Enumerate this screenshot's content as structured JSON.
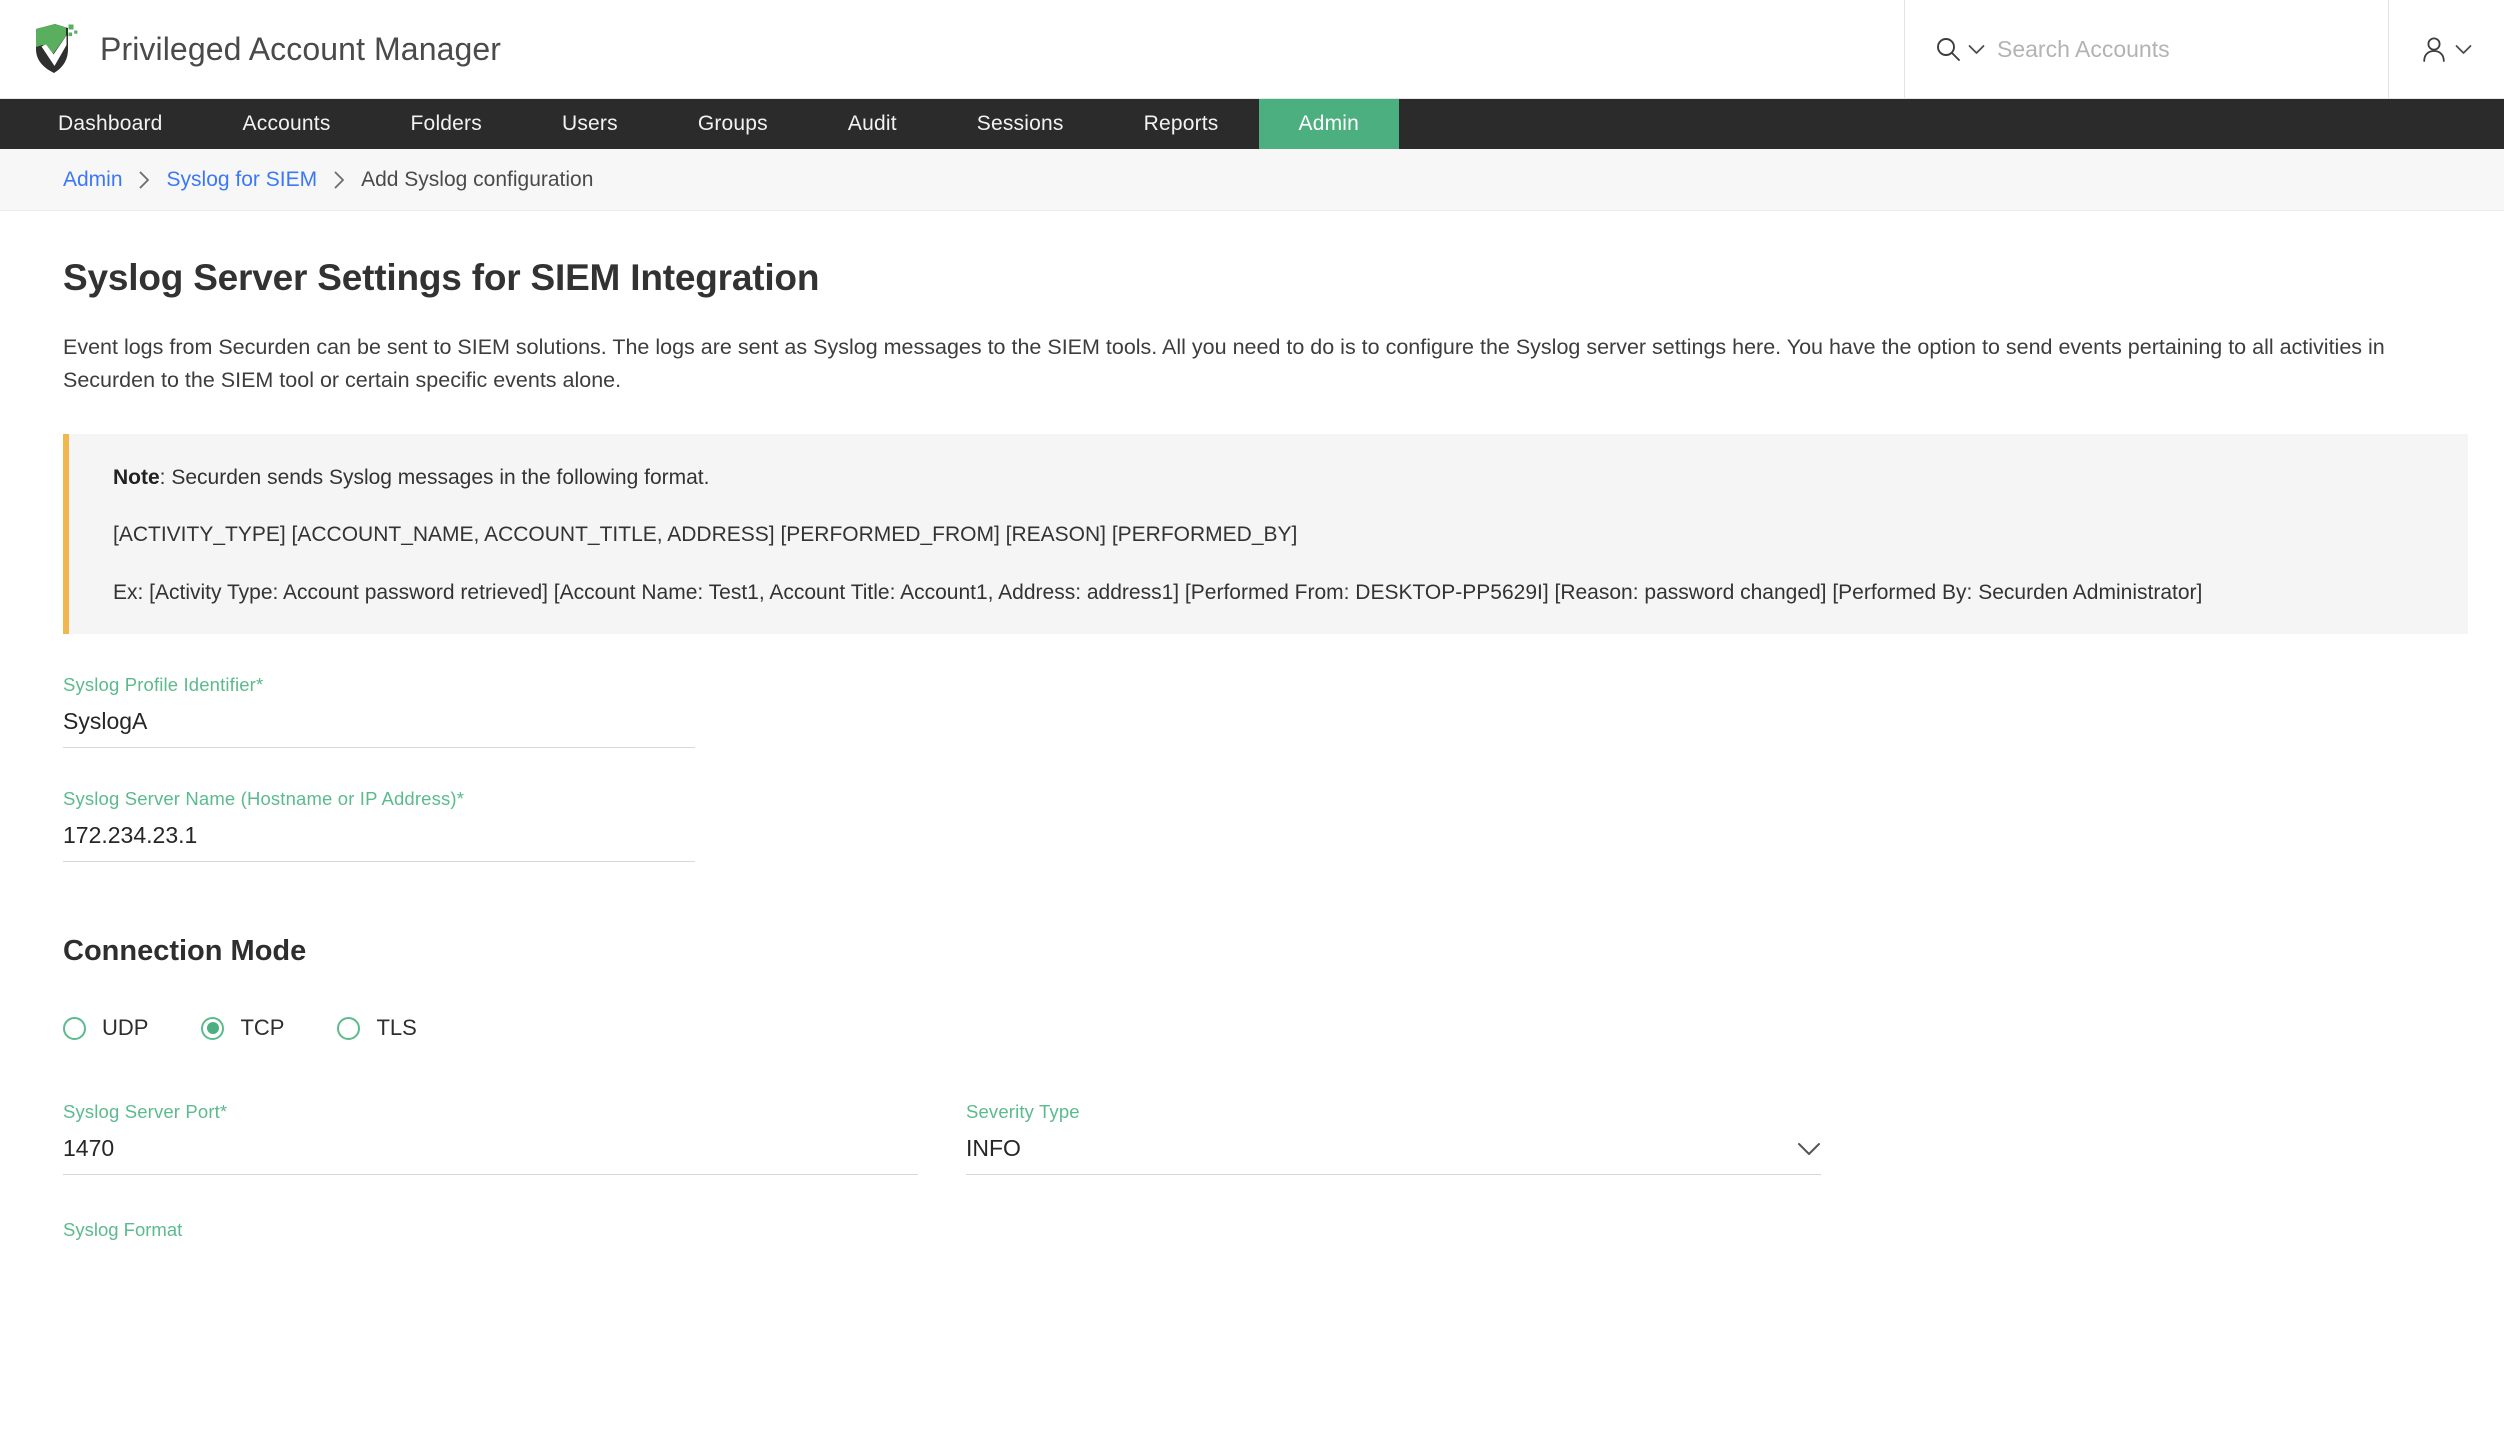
{
  "header": {
    "brand_title": "Privileged Account Manager",
    "logo_icon": "shield-logo-icon",
    "search_icon": "search-icon",
    "search_chevron_icon": "chevron-down-icon",
    "search_placeholder": "Search Accounts",
    "search_value": "",
    "user_icon": "user-icon",
    "user_chevron_icon": "chevron-down-icon"
  },
  "nav": {
    "items": [
      {
        "label": "Dashboard",
        "active": false
      },
      {
        "label": "Accounts",
        "active": false
      },
      {
        "label": "Folders",
        "active": false
      },
      {
        "label": "Users",
        "active": false
      },
      {
        "label": "Groups",
        "active": false
      },
      {
        "label": "Audit",
        "active": false
      },
      {
        "label": "Sessions",
        "active": false
      },
      {
        "label": "Reports",
        "active": false
      },
      {
        "label": "Admin",
        "active": true
      }
    ],
    "active_color": "#4caf7f",
    "bar_color": "#2b2b2b"
  },
  "breadcrumb": {
    "items": [
      {
        "label": "Admin",
        "is_link": true
      },
      {
        "label": "Syslog for SIEM",
        "is_link": true
      },
      {
        "label": "Add Syslog configuration",
        "is_link": false
      }
    ],
    "separator_icon": "chevron-right-icon",
    "link_color": "#3b78f7"
  },
  "page": {
    "title": "Syslog Server Settings for SIEM Integration",
    "description": "Event logs from Securden can be sent to SIEM solutions. The logs are sent as Syslog messages to the SIEM tools. All you need to do is to configure the Syslog server settings here. You have the option to send events pertaining to all activities in Securden to the SIEM tool or certain specific events alone."
  },
  "note": {
    "accent_color": "#f2b64e",
    "background_color": "#f5f5f5",
    "label": "Note",
    "intro_rest": ": Securden sends Syslog messages in the following format.",
    "format_line": "[ACTIVITY_TYPE] [ACCOUNT_NAME, ACCOUNT_TITLE, ADDRESS] [PERFORMED_FROM] [REASON] [PERFORMED_BY]",
    "example_line": "Ex: [Activity Type: Account password retrieved] [Account Name: Test1, Account Title: Account1, Address: address1] [Performed From: DESKTOP-PP5629I] [Reason: password changed] [Performed By: Securden Administrator]"
  },
  "form": {
    "label_color": "#5bbb8d",
    "profile_identifier": {
      "label": "Syslog Profile Identifier*",
      "value": "SyslogA",
      "placeholder": ""
    },
    "server_name": {
      "label": "Syslog Server Name (Hostname or IP Address)*",
      "value": "172.234.23.1",
      "placeholder": ""
    },
    "connection_mode": {
      "section_title": "Connection Mode",
      "options": [
        {
          "label": "UDP",
          "selected": false
        },
        {
          "label": "TCP",
          "selected": true
        },
        {
          "label": "TLS",
          "selected": false
        }
      ],
      "selected": "TCP"
    },
    "server_port": {
      "label": "Syslog Server Port*",
      "value": "1470",
      "placeholder": ""
    },
    "severity_type": {
      "label": "Severity Type",
      "value": "INFO",
      "chevron_icon": "chevron-down-icon"
    },
    "syslog_format": {
      "label": "Syslog Format"
    }
  }
}
